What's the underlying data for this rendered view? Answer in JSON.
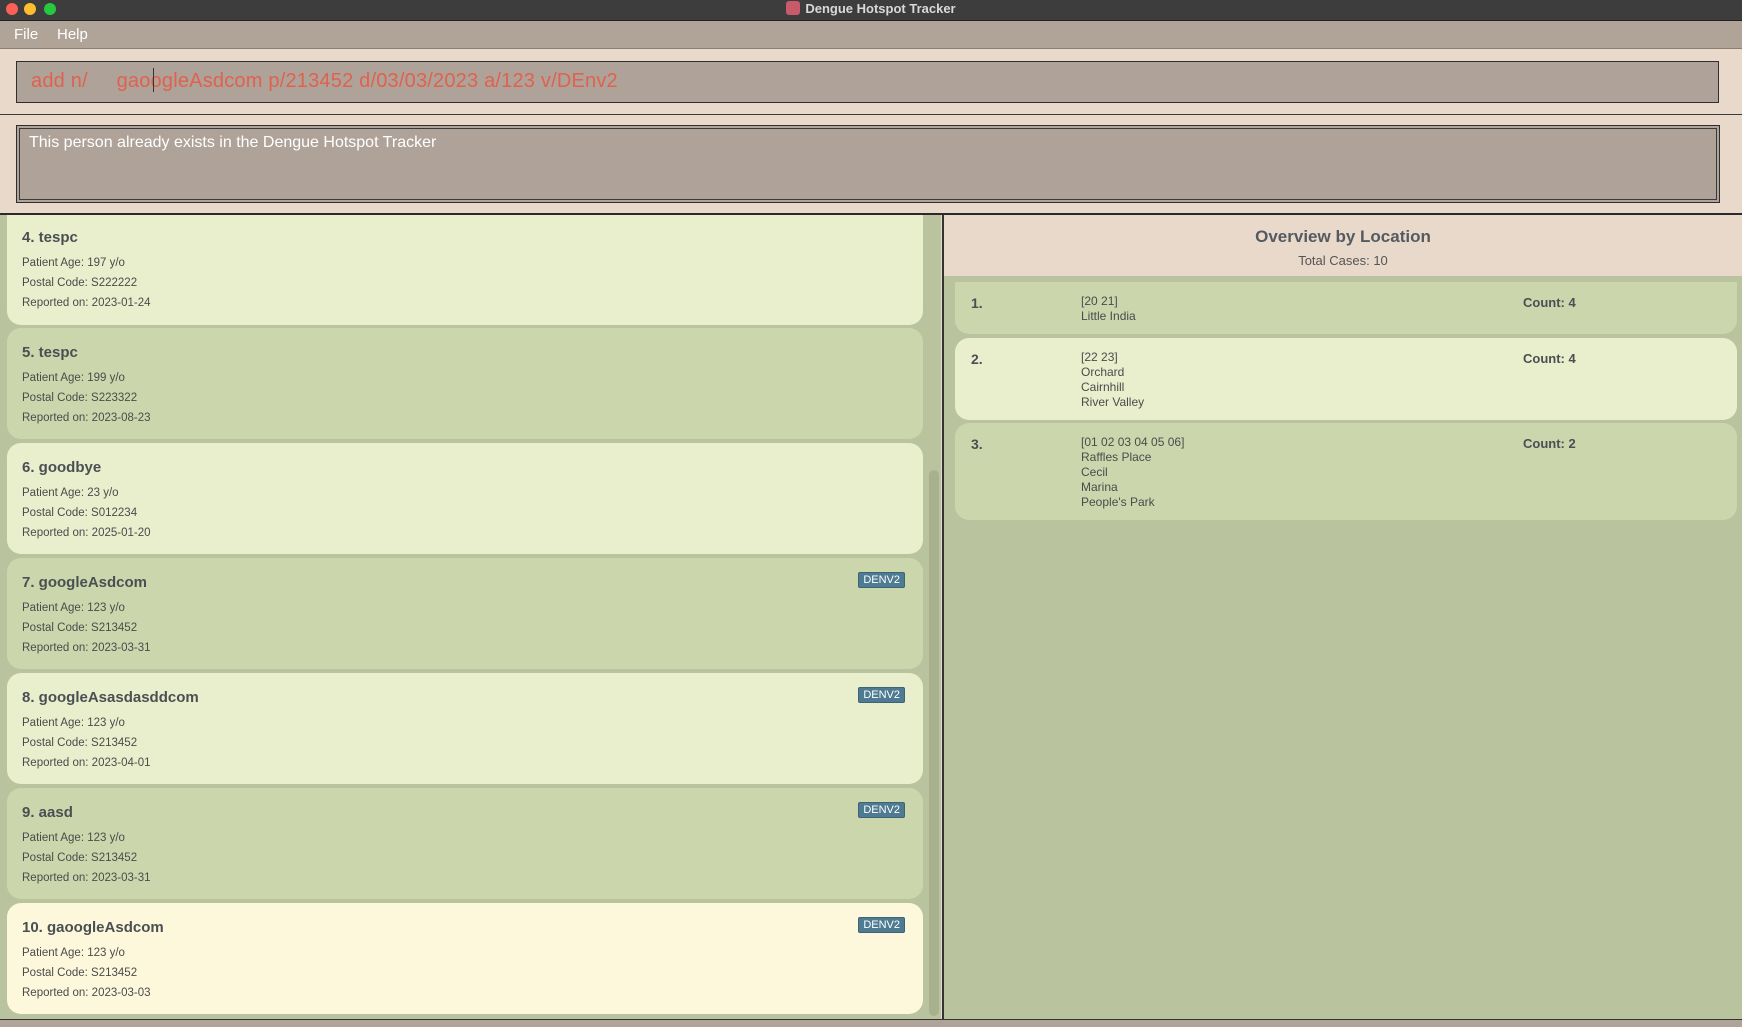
{
  "window": {
    "title": "Dengue Hotspot Tracker"
  },
  "menu": {
    "file": "File",
    "help": "Help"
  },
  "command": {
    "value": "add n/     gaoogleAsdcom p/213452 d/03/03/2023 a/123 v/DEnv2"
  },
  "result": {
    "message": "This person already exists in the Dengue Hotspot Tracker"
  },
  "patients": [
    {
      "title": "4. tespc",
      "age": "Patient Age: 197 y/o",
      "postal": "Postal Code: S222222",
      "date": "Reported on: 2023-01-24",
      "tag": ""
    },
    {
      "title": "5. tespc",
      "age": "Patient Age: 199 y/o",
      "postal": "Postal Code: S223322",
      "date": "Reported on: 2023-08-23",
      "tag": ""
    },
    {
      "title": "6. goodbye",
      "age": "Patient Age: 23 y/o",
      "postal": "Postal Code: S012234",
      "date": "Reported on: 2025-01-20",
      "tag": ""
    },
    {
      "title": "7. googleAsdcom",
      "age": "Patient Age: 123 y/o",
      "postal": "Postal Code: S213452",
      "date": "Reported on: 2023-03-31",
      "tag": "DENV2"
    },
    {
      "title": "8. googleAsasdasddcom",
      "age": "Patient Age: 123 y/o",
      "postal": "Postal Code: S213452",
      "date": "Reported on: 2023-04-01",
      "tag": "DENV2"
    },
    {
      "title": "9. aasd",
      "age": "Patient Age: 123 y/o",
      "postal": "Postal Code: S213452",
      "date": "Reported on: 2023-03-31",
      "tag": "DENV2"
    },
    {
      "title": "10. gaoogleAsdcom",
      "age": "Patient Age: 123 y/o",
      "postal": "Postal Code: S213452",
      "date": "Reported on: 2023-03-03",
      "tag": "DENV2"
    }
  ],
  "overview": {
    "title": "Overview by Location",
    "total": "Total Cases: 10",
    "locations": [
      {
        "num": "1.",
        "codes": "[20 21]",
        "areas": [
          "Little India"
        ],
        "count": "Count: 4"
      },
      {
        "num": "2.",
        "codes": "[22 23]",
        "areas": [
          "Orchard",
          "Cairnhill",
          "River Valley"
        ],
        "count": "Count: 4"
      },
      {
        "num": "3.",
        "codes": "[01 02 03 04 05 06]",
        "areas": [
          "Raffles Place",
          "Cecil",
          "Marina",
          "People's Park"
        ],
        "count": "Count: 2"
      }
    ]
  },
  "colors": {
    "accent_tag": "#4e7b92",
    "command_text": "#e0614f",
    "panel_bg": "#b9c49f"
  }
}
